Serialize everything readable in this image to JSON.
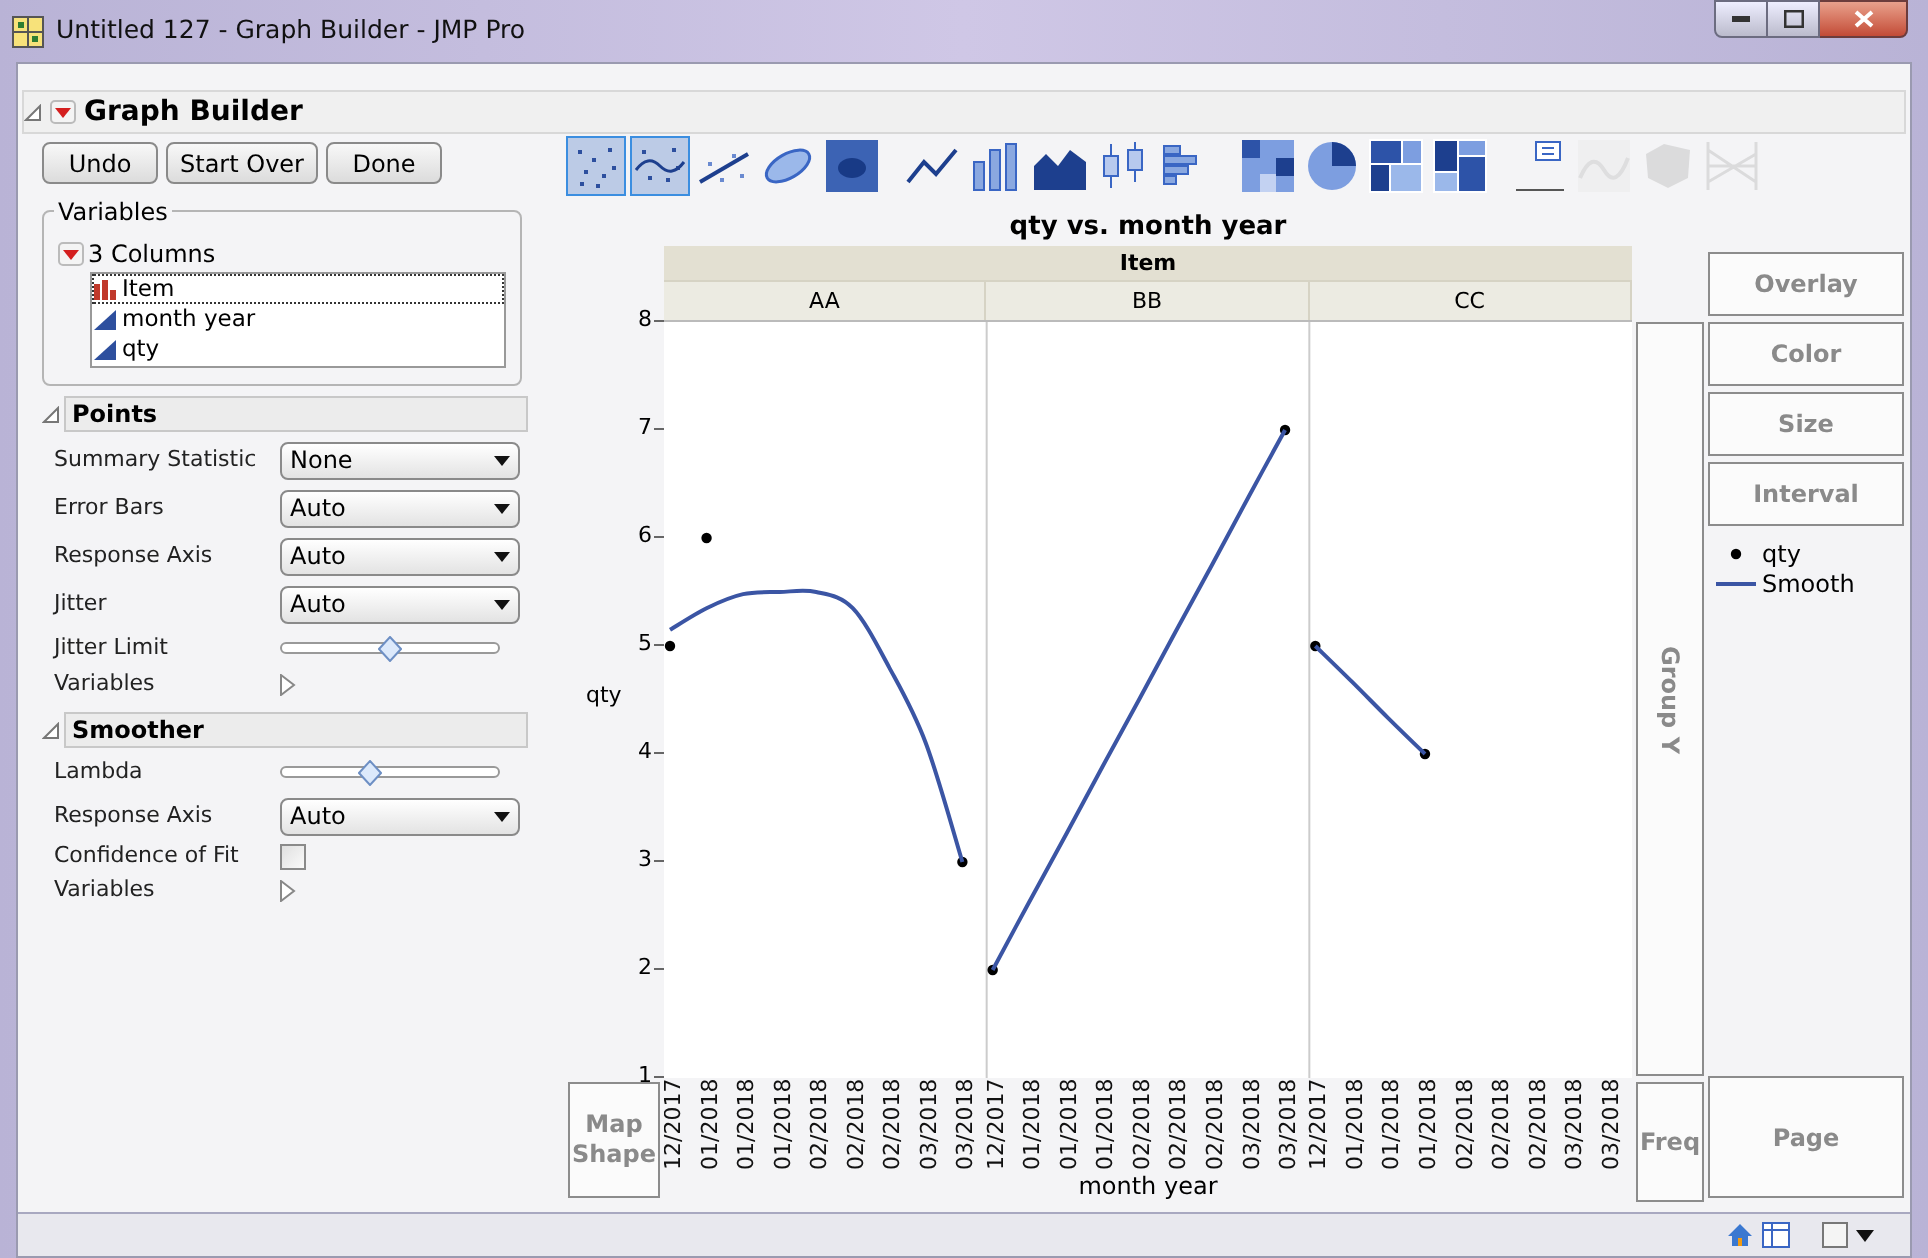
{
  "window": {
    "title": "Untitled 127 - Graph Builder - JMP Pro"
  },
  "header": {
    "title": "Graph Builder",
    "expanded": true
  },
  "buttons": [
    "Undo",
    "Start Over",
    "Done"
  ],
  "variables": {
    "title": "Variables",
    "group": "3 Columns",
    "columns": [
      {
        "name": "Item",
        "kind": "nominal",
        "selected": true
      },
      {
        "name": "month year",
        "kind": "continuous",
        "selected": false
      },
      {
        "name": "qty",
        "kind": "continuous",
        "selected": false
      }
    ]
  },
  "sections": [
    {
      "title": "Points",
      "expanded": true,
      "rows": [
        {
          "kind": "dropdown",
          "label": "Summary Statistic",
          "value": "None"
        },
        {
          "kind": "dropdown",
          "label": "Error Bars",
          "value": "Auto"
        },
        {
          "kind": "dropdown",
          "label": "Response Axis",
          "value": "Auto"
        },
        {
          "kind": "dropdown",
          "label": "Jitter",
          "value": "Auto"
        },
        {
          "kind": "slider",
          "label": "Jitter Limit",
          "level": 0.5
        },
        {
          "kind": "expander",
          "label": "Variables",
          "expanded": false
        }
      ]
    },
    {
      "title": "Smoother",
      "expanded": true,
      "rows": [
        {
          "kind": "slider",
          "label": "Lambda",
          "level": 0.41
        },
        {
          "kind": "dropdown",
          "label": "Response Axis",
          "value": "Auto"
        },
        {
          "kind": "checkbox",
          "label": "Confidence of Fit",
          "checked": false
        },
        {
          "kind": "expander",
          "label": "Variables",
          "expanded": false
        }
      ]
    }
  ],
  "toolbar": [
    {
      "tools": [
        {
          "kind": "points",
          "selected": true,
          "disabled": false
        },
        {
          "kind": "smoother",
          "selected": true,
          "disabled": false
        },
        {
          "kind": "line-fit",
          "selected": false,
          "disabled": false
        },
        {
          "kind": "ellipse",
          "selected": false,
          "disabled": false
        },
        {
          "kind": "contour",
          "selected": false,
          "disabled": false
        }
      ]
    },
    {
      "tools": [
        {
          "kind": "line",
          "selected": false,
          "disabled": false
        },
        {
          "kind": "bar",
          "selected": false,
          "disabled": false
        },
        {
          "kind": "area",
          "selected": false,
          "disabled": false
        },
        {
          "kind": "box",
          "selected": false,
          "disabled": false
        },
        {
          "kind": "histogram",
          "selected": false,
          "disabled": false
        }
      ]
    },
    {
      "tools": [
        {
          "kind": "heatmap",
          "selected": false,
          "disabled": false
        },
        {
          "kind": "pie",
          "selected": false,
          "disabled": false
        },
        {
          "kind": "treemap",
          "selected": false,
          "disabled": false
        },
        {
          "kind": "mosaic",
          "selected": false,
          "disabled": false
        }
      ]
    },
    {
      "tools": [
        {
          "kind": "caption",
          "selected": false,
          "disabled": false
        },
        {
          "kind": "formula",
          "selected": false,
          "disabled": true
        },
        {
          "kind": "map",
          "selected": false,
          "disabled": true
        },
        {
          "kind": "parallel",
          "selected": false,
          "disabled": true
        }
      ]
    }
  ],
  "graph": {
    "group_x": "Item",
    "facets": [
      "AA",
      "BB",
      "CC"
    ],
    "chart_data": {
      "type": "line",
      "title": "qty vs. month year",
      "xlabel": "month year",
      "ylabel": "qty",
      "ylim": [
        1,
        8
      ],
      "yticks": [
        1,
        2,
        3,
        4,
        5,
        6,
        7,
        8
      ],
      "categories": [
        "12/2017",
        "01/2018",
        "01/2018",
        "01/2018",
        "02/2018",
        "02/2018",
        "02/2018",
        "03/2018",
        "03/2018",
        "12/2017",
        "01/2018",
        "01/2018",
        "01/2018",
        "02/2018",
        "02/2018",
        "02/2018",
        "03/2018",
        "03/2018",
        "12/2017",
        "01/2018",
        "01/2018",
        "01/2018",
        "02/2018",
        "02/2018",
        "02/2018",
        "03/2018",
        "03/2018"
      ],
      "series": [
        {
          "name": "qty",
          "type": "scatter",
          "marker": "circle",
          "color": "#000000",
          "values": [
            5,
            6,
            null,
            null,
            null,
            null,
            null,
            null,
            3,
            2,
            null,
            null,
            null,
            null,
            null,
            null,
            null,
            7,
            5,
            null,
            null,
            4,
            null,
            null,
            null,
            null,
            null
          ]
        },
        {
          "name": "Smooth",
          "color": "#3b55a4",
          "values": [
            5.15,
            5.35,
            5.48,
            5.5,
            5.5,
            5.35,
            4.8,
            4.1,
            3.0,
            2,
            2.63,
            3.25,
            3.88,
            4.5,
            5.13,
            5.75,
            6.38,
            7,
            5,
            4.67,
            4.33,
            4,
            null,
            null,
            null,
            null,
            null
          ]
        }
      ]
    },
    "drop_zones": [
      {
        "kind": "overlay",
        "label": "Overlay"
      },
      {
        "kind": "color",
        "label": "Color"
      },
      {
        "kind": "size",
        "label": "Size"
      },
      {
        "kind": "interval",
        "label": "Interval"
      },
      {
        "kind": "group_y",
        "label": "Group Y"
      },
      {
        "kind": "map_shape",
        "label": "Map Shape"
      },
      {
        "kind": "freq",
        "label": "Freq"
      },
      {
        "kind": "page",
        "label": "Page"
      }
    ]
  }
}
